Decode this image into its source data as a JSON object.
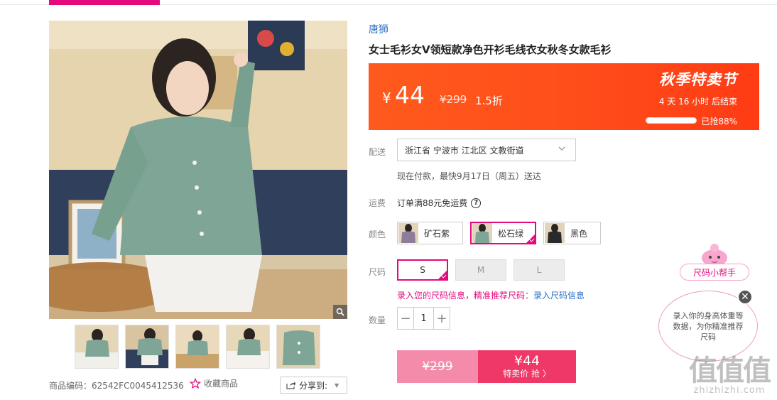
{
  "brand": "唐狮",
  "title": "女士毛衫女V领短款净色开衫毛线衣女秋冬女款毛衫",
  "price": {
    "currency": "¥",
    "amount": "44",
    "original": "¥299",
    "discount": "1.5折",
    "promo_name": "秋季特卖节",
    "countdown": "4 天 16 小时 后结束",
    "grabbed_label": "已抢88%",
    "grabbed_fraction": 0.88
  },
  "shipping": {
    "label": "配送",
    "address": "浙江省 宁波市 江北区 文教街道",
    "note": "现在付款，最快9月17日（周五）送达"
  },
  "freight": {
    "label": "运费",
    "text": "订单满88元免运费",
    "help_icon": "?"
  },
  "colors": {
    "label": "颜色",
    "options": [
      {
        "name": "矿石紫",
        "selected": false
      },
      {
        "name": "松石绿",
        "selected": true
      },
      {
        "name": "黑色",
        "selected": false
      }
    ]
  },
  "sizes": {
    "label": "尺码",
    "options": [
      {
        "name": "S",
        "state": "selected"
      },
      {
        "name": "M",
        "state": "disabled"
      },
      {
        "name": "L",
        "state": "disabled"
      }
    ],
    "hint": "录入您的尺码信息，精准推荐尺码：",
    "hint_link": "录入尺码信息"
  },
  "quantity": {
    "label": "数量",
    "minus": "−",
    "value": "1",
    "plus": "+"
  },
  "buy": {
    "original": "¥299",
    "price": "¥44",
    "action": "特卖价 抢 〉"
  },
  "product_code": "商品编码：62542FC0045412536",
  "favorite": "收藏商品",
  "share": "分享到:",
  "helper": {
    "title": "尺码小帮手",
    "body": "录入你的身高体重等数据，为你精准推荐尺码",
    "close": "✕"
  },
  "watermark": {
    "big": "值值值",
    "small": "zhizhizhi.com"
  },
  "colors_theme": {
    "accent": "#e5097f",
    "promo": "#ff4d1a",
    "buy": "#ef3868",
    "link": "#2a6fc9"
  }
}
